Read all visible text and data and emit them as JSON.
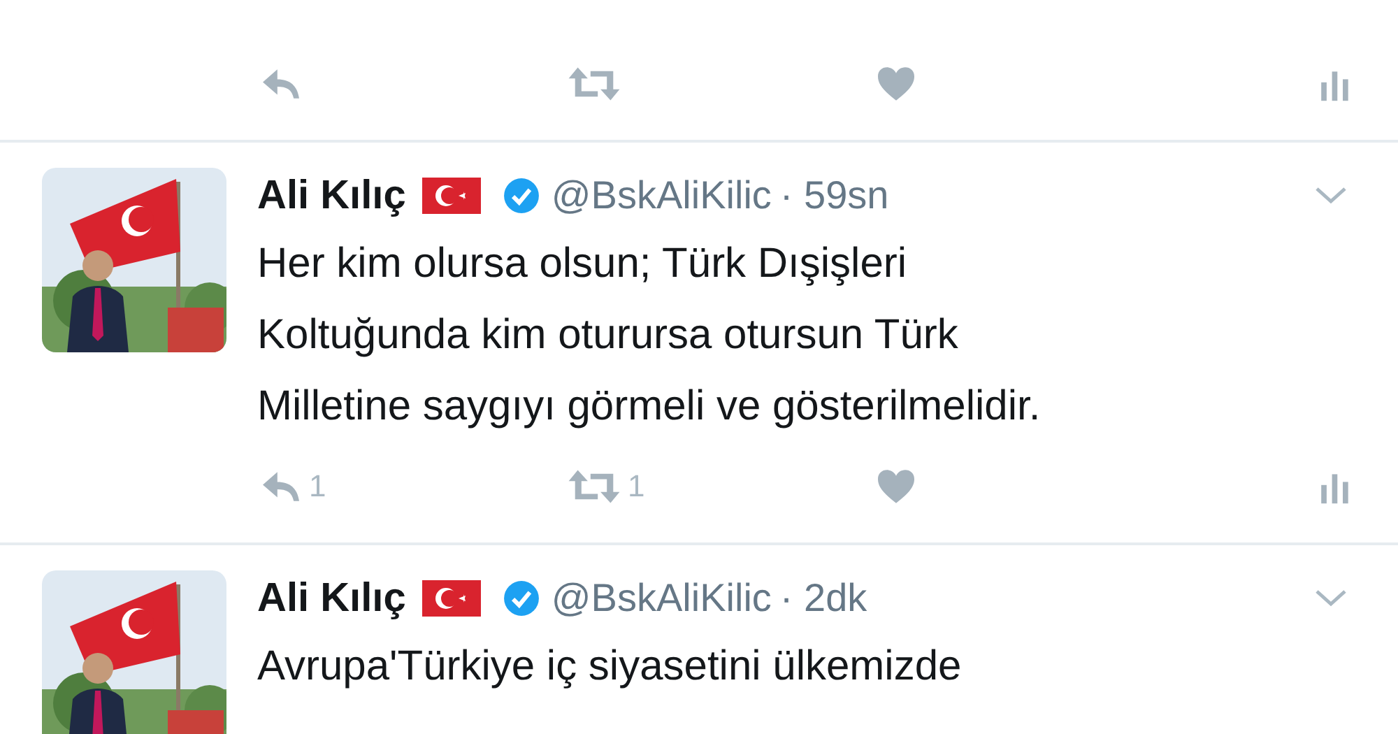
{
  "tweets": [
    {
      "kind": "actions"
    },
    {
      "kind": "full",
      "name": "Ali Kılıç",
      "handle": "@BskAliKilic",
      "time": "· 59sn",
      "text": "Her kim olursa olsun; Türk Dışişleri\nKoltuğunda kim oturursa otursun Türk\nMilletine saygıyı görmeli ve gösterilmelidir.",
      "replies": "1",
      "retweets": "1"
    },
    {
      "kind": "full",
      "name": "Ali Kılıç",
      "handle": "@BskAliKilic",
      "time": "· 2dk",
      "text": "Avrupa'Türkiye iç siyasetini ülkemizde"
    }
  ]
}
